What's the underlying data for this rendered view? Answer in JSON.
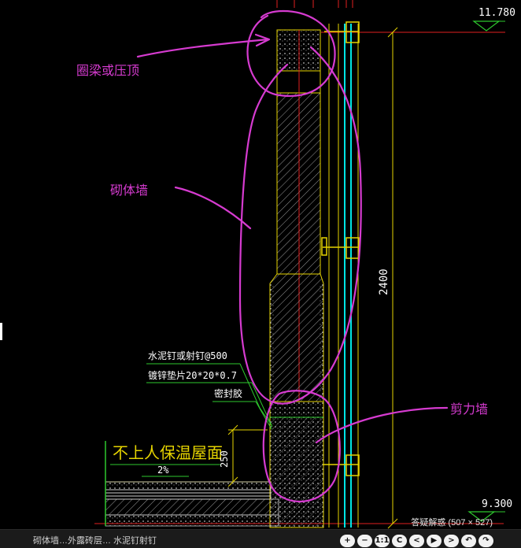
{
  "annotations": {
    "ring_beam": "圈梁或压顶",
    "masonry_wall": "砌体墙",
    "shear_wall": "剪力墙"
  },
  "cad_text": {
    "elev_top": "11.780",
    "elev_bottom": "9.300",
    "dim_vertical": "2400",
    "dim_250": "250",
    "note_line1": "水泥钉或射钉@500",
    "note_line2": "镀锌垫片20*20*0.7",
    "note_line3": "密封胶",
    "roof_label": "不上人保温屋面",
    "slope": "2%"
  },
  "viewer": {
    "caption": "答疑解惑 (507 × 527)",
    "bottom_text": "砌体墙…外露砖层… 水泥钉射钉",
    "tools": [
      "+",
      "−",
      "1:1",
      "C",
      "<",
      "▶",
      ">",
      "↶",
      "↷"
    ]
  },
  "colors": {
    "magenta": "#d63bd0",
    "yellow": "#e6d400",
    "cyan": "#00e5e5",
    "red": "#e02020",
    "green": "#2ec82e"
  }
}
